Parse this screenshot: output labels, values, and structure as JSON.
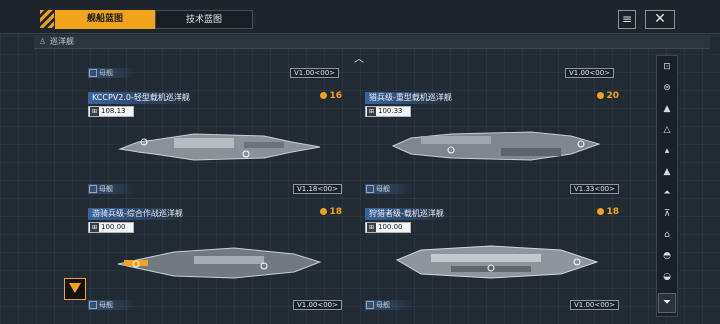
{
  "tabs": [
    {
      "label": "舰船蓝图"
    },
    {
      "label": "技术蓝图"
    }
  ],
  "header_buttons": {
    "list_icon": "list-icon",
    "close_icon": "close-icon",
    "close_glyph": "✕"
  },
  "breadcrumb": {
    "icon": "fleet-icon",
    "label": "巡洋舰"
  },
  "collapse_icon": "chevron-up-icon",
  "top_partial": {
    "left": {
      "type": "母舰",
      "version": "V1.00<00>"
    },
    "right": {
      "version": "V1.00<00>"
    }
  },
  "cards": [
    {
      "title": "KCCPV2.0-轻型载机巡洋舰",
      "cost": "16",
      "stat_icon": "hangar-icon",
      "stat": "108.13",
      "type": "母舰",
      "version": "V1.18<00>"
    },
    {
      "title": "猎兵级-重型载机巡洋舰",
      "cost": "20",
      "stat_icon": "hangar-icon",
      "stat": "100.33",
      "type": "母舰",
      "version": "V1.33<00>"
    },
    {
      "title": "游骑兵级-综合作战巡洋舰",
      "cost": "18",
      "stat_icon": "hangar-icon",
      "stat": "100.00",
      "type": "母舰",
      "version": "V1.00<00>"
    },
    {
      "title": "狩猎者级-载机巡洋舰",
      "cost": "18",
      "stat_icon": "hangar-icon",
      "stat": "100.00",
      "type": "母舰",
      "version": "V1.00<00>"
    }
  ],
  "colors": {
    "accent": "#f0a51c",
    "title_blue": "#3c6eb4",
    "panel": "#1e252d"
  },
  "sidebar": {
    "icons": [
      "frigate-icon",
      "destroyer-icon",
      "cruiser-icon",
      "battlecruiser-icon",
      "auxiliary-icon",
      "carrier-icon",
      "battleship-icon",
      "station-icon",
      "corvette-icon",
      "dreadnought-icon",
      "misc-icon"
    ],
    "filter_icon": "filter-icon"
  },
  "emblem_icon": "faction-emblem-icon"
}
